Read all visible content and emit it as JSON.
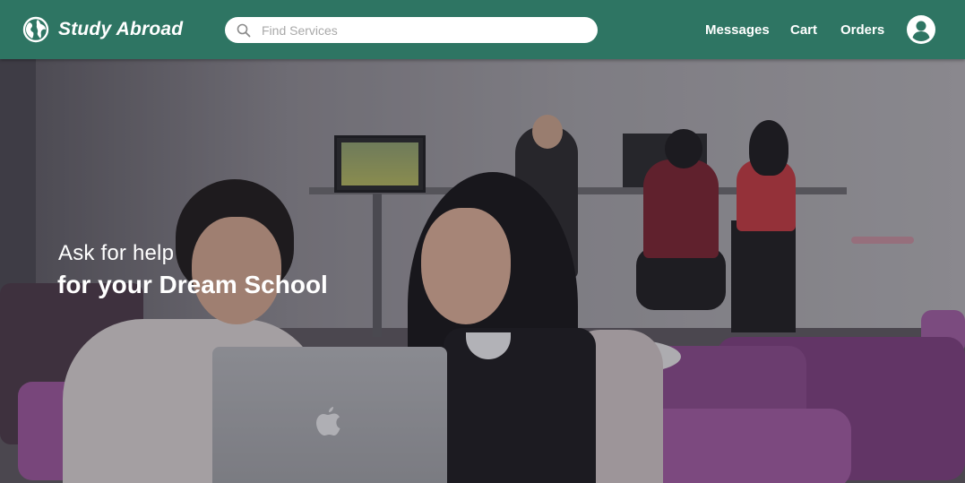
{
  "header": {
    "brand": "Study Abroad",
    "brand_icon": "globe-icon",
    "search": {
      "placeholder": "Find Services",
      "value": "",
      "icon": "search-icon"
    },
    "nav": {
      "messages": "Messages",
      "cart": "Cart",
      "orders": "Orders"
    },
    "avatar_icon": "user-avatar-icon",
    "background_color": "#2e7563"
  },
  "hero": {
    "line1": "Ask for help",
    "line2": "for your Dream School"
  }
}
